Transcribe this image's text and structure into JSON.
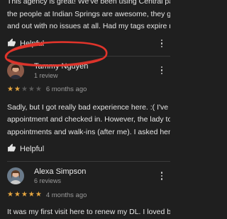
{
  "reviews": [
    {
      "text_lines": [
        "This agency is great! We've been using Central park in BA but",
        "the people at Indian Springs are awesome, they get you in",
        "and out with no issues at all. Had my tags expire nearly a y..."
      ],
      "helpful_label": "Helpful"
    },
    {
      "author": "Tammy Nguyen",
      "meta": "1 review",
      "rating": 2,
      "time": "6 months ago",
      "text_lines": [
        "Sadly, but I got really bad experience here. :(  I've made an",
        "appointment and checked in. However, the lady took other",
        "appointments and walk-ins (after me). I asked her to chec..."
      ],
      "helpful_label": "Helpful"
    },
    {
      "author": "Alexa Simpson",
      "meta": "6 reviews",
      "rating": 5,
      "time": "4 months ago",
      "text_lines": [
        "It was my first visit here to renew my DL. I loved being able"
      ]
    }
  ],
  "colors": {
    "background": "#1f1f1f",
    "star_on": "#e6a640",
    "star_off": "#5a5a5a",
    "annotation": "#e0342b"
  },
  "icons": {
    "helpful": "thumbs-up-icon",
    "more": "more-vertical-icon"
  }
}
